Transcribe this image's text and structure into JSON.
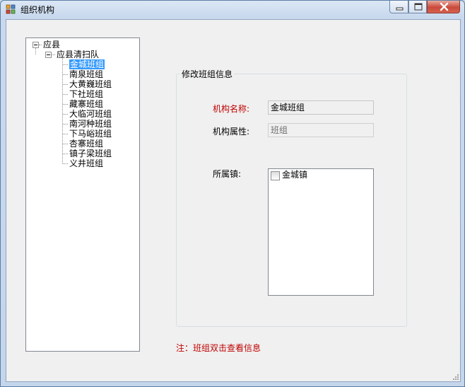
{
  "window": {
    "title": "组织机构"
  },
  "tree": {
    "root": "应县",
    "team": "应县清扫队",
    "items": [
      "金城班组",
      "南泉班组",
      "大黄巍班组",
      "下社班组",
      "藏寨班组",
      "大临河班组",
      "南河种班组",
      "下马峪班组",
      "杏寨班组",
      "镇子梁班组",
      "义井班组"
    ],
    "selected_index": 0
  },
  "form": {
    "legend": "修改班组信息",
    "name_label": "机构名称:",
    "name_value": "金城班组",
    "type_label": "机构属性:",
    "type_value": "班组",
    "town_label": "所属镇:",
    "towns": [
      {
        "label": "金城镇",
        "checked": false
      }
    ]
  },
  "note": "注：班组双击查看信息",
  "icons": {
    "app": "org-icon",
    "minimize": "minimize-icon",
    "maximize": "maximize-icon",
    "close": "close-icon"
  }
}
